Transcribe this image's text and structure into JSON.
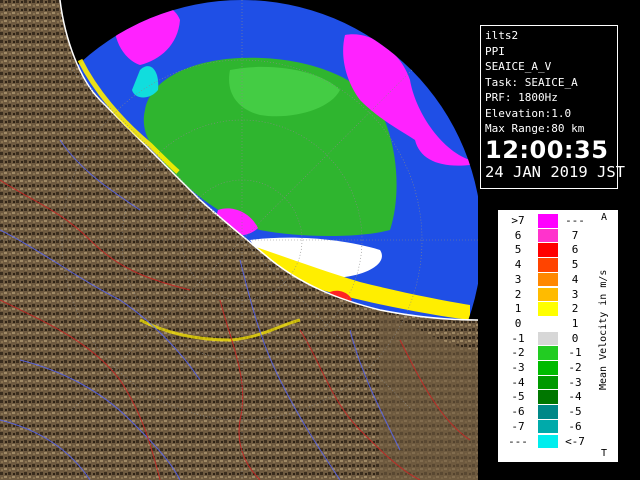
{
  "info": {
    "lines": [
      "ilts2",
      "PPI",
      "SEAICE_A_V",
      "Task: SEAICE_A",
      "PRF: 1800Hz",
      "Elevation:1.0",
      "Max Range:80 km"
    ],
    "time": "12:00:35",
    "date": "24 JAN 2019 JST"
  },
  "legend": {
    "title": "Mean Velocity in m/s",
    "top_marker": "A",
    "bottom_marker": "T",
    "rows": [
      {
        "left": ">7",
        "right": "---",
        "color": "#ff00ff"
      },
      {
        "left": "6",
        "right": "7",
        "color": "#ff33cc"
      },
      {
        "left": "5",
        "right": "6",
        "color": "#ff0000"
      },
      {
        "left": "4",
        "right": "5",
        "color": "#ff4400"
      },
      {
        "left": "3",
        "right": "4",
        "color": "#ff8800"
      },
      {
        "left": "2",
        "right": "3",
        "color": "#ffbb00"
      },
      {
        "left": "1",
        "right": "2",
        "color": "#ffff00"
      },
      {
        "left": "0",
        "right": "1",
        "color": "#ffffff"
      },
      {
        "left": "-1",
        "right": "0",
        "color": "#d7d7d7"
      },
      {
        "left": "-2",
        "right": "-1",
        "color": "#22cc22"
      },
      {
        "left": "-3",
        "right": "-2",
        "color": "#00bb00"
      },
      {
        "left": "-4",
        "right": "-3",
        "color": "#009900"
      },
      {
        "left": "-5",
        "right": "-4",
        "color": "#007700"
      },
      {
        "left": "-6",
        "right": "-5",
        "color": "#008888"
      },
      {
        "left": "-7",
        "right": "-6",
        "color": "#00aaaa"
      },
      {
        "left": "---",
        "right": "<-7",
        "color": "#00eeee"
      }
    ]
  },
  "colors": {
    "range_disk": "#1f4fe6",
    "land": "#7a6548",
    "coast_line": "#ffffff",
    "river_blue": "#5566ff",
    "boundary_red": "#cc2222"
  }
}
